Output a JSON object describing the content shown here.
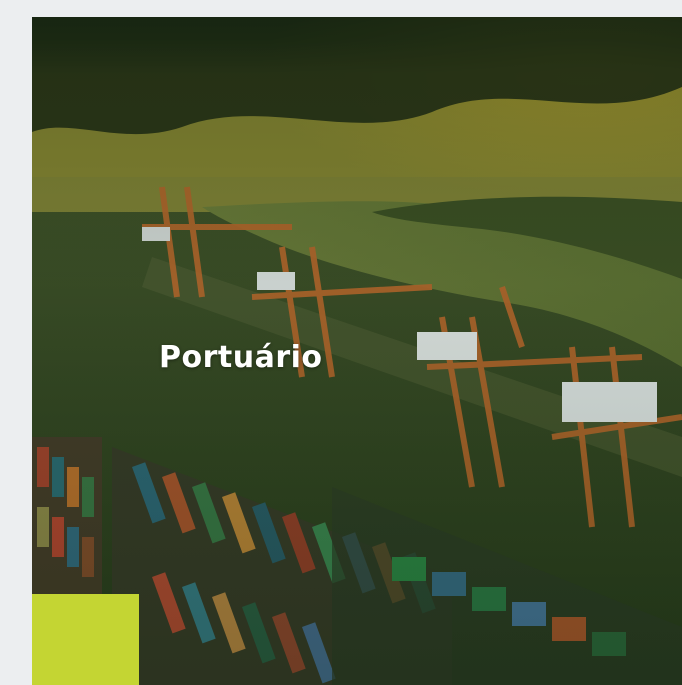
{
  "card": {
    "title": "Portuário"
  },
  "colors": {
    "page_background": "#eceef0",
    "accent": "#c4d533",
    "title_text": "#ffffff",
    "tint": "#2f5a1e"
  }
}
